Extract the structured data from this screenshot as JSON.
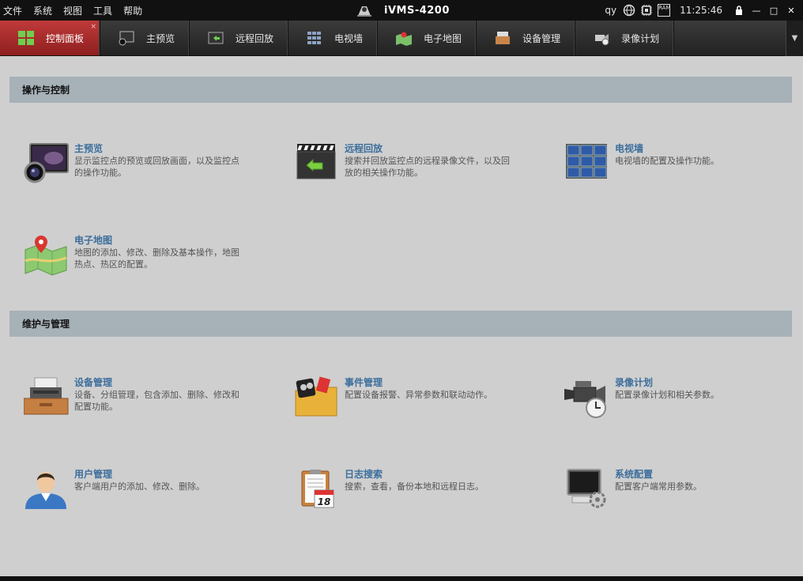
{
  "titlebar": {
    "menu": [
      "文件",
      "系统",
      "视图",
      "工具",
      "帮助"
    ],
    "app_title": "iVMS-4200",
    "user": "qy",
    "clock": "11:25:46",
    "ram_label": "RAM",
    "win_lock": "🔒",
    "win_min": "—",
    "win_max": "□",
    "win_close": "✕"
  },
  "tabs": [
    {
      "label": "控制面板",
      "icon": "grid-icon",
      "active": true
    },
    {
      "label": "主预览",
      "icon": "preview-icon"
    },
    {
      "label": "远程回放",
      "icon": "playback-icon"
    },
    {
      "label": "电视墙",
      "icon": "tvwall-icon"
    },
    {
      "label": "电子地图",
      "icon": "map-icon"
    },
    {
      "label": "设备管理",
      "icon": "device-icon"
    },
    {
      "label": "录像计划",
      "icon": "camera-icon"
    }
  ],
  "tab_close": "×",
  "tab_dropdown": "▼",
  "sections": {
    "ops": {
      "title": "操作与控制",
      "items": [
        {
          "title": "主预览",
          "desc": "显示监控点的预览或回放画面，以及监控点的操作功能。"
        },
        {
          "title": "远程回放",
          "desc": "搜索并回放监控点的远程录像文件，以及回放的相关操作功能。"
        },
        {
          "title": "电视墙",
          "desc": "电视墙的配置及操作功能。"
        },
        {
          "title": "电子地图",
          "desc": "地图的添加、修改、删除及基本操作，地图热点、热区的配置。"
        }
      ]
    },
    "maint": {
      "title": "维护与管理",
      "items": [
        {
          "title": "设备管理",
          "desc": "设备、分组管理，包含添加、删除、修改和配置功能。"
        },
        {
          "title": "事件管理",
          "desc": "配置设备报警、异常参数和联动动作。"
        },
        {
          "title": "录像计划",
          "desc": "配置录像计划和相关参数。"
        },
        {
          "title": "用户管理",
          "desc": "客户端用户的添加、修改、删除。"
        },
        {
          "title": "日志搜索",
          "desc": "搜索，查看，备份本地和远程日志。"
        },
        {
          "title": "系统配置",
          "desc": "配置客户端常用参数。"
        }
      ]
    }
  },
  "log_date": "18",
  "colors": {
    "accent": "#c03a3a",
    "item_title": "#3c6e9c",
    "section_bg": "#a7b1b8",
    "bg": "#cfcfcf"
  }
}
